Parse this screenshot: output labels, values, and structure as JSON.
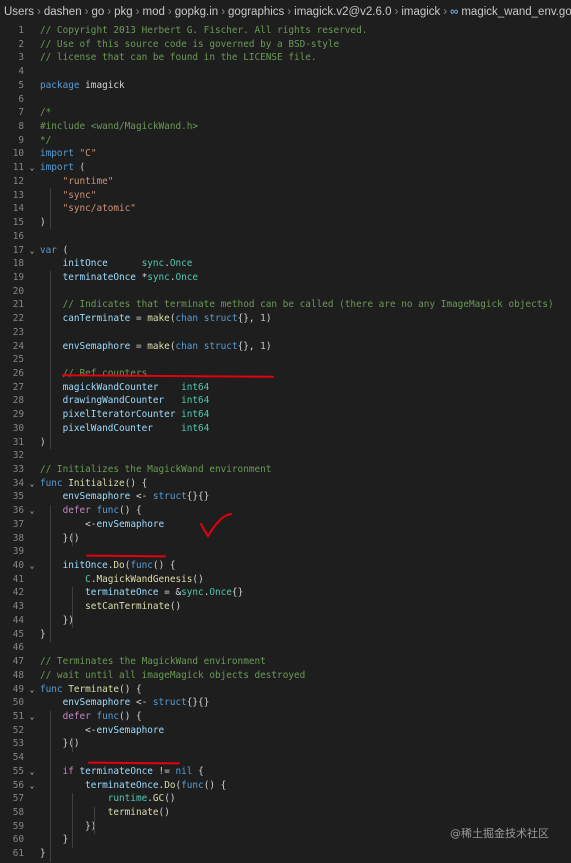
{
  "breadcrumb": {
    "items": [
      "Users",
      "dashen",
      "go",
      "pkg",
      "mod",
      "gopkg.in",
      "gographics",
      "imagick.v2@v2.6.0",
      "imagick"
    ],
    "file": "magick_wand_env.go"
  },
  "lines": [
    {
      "n": "1",
      "t": [
        [
          "cm",
          "// Copyright 2013 Herbert G. Fischer. All rights reserved."
        ]
      ]
    },
    {
      "n": "2",
      "t": [
        [
          "cm",
          "// Use of this source code is governed by a BSD-style"
        ]
      ]
    },
    {
      "n": "3",
      "t": [
        [
          "cm",
          "// license that can be found in the LICENSE file."
        ]
      ]
    },
    {
      "n": "4",
      "t": []
    },
    {
      "n": "5",
      "t": [
        [
          "kw",
          "package"
        ],
        [
          "code",
          " imagick"
        ]
      ]
    },
    {
      "n": "6",
      "t": []
    },
    {
      "n": "7",
      "t": [
        [
          "cm",
          "/*"
        ]
      ]
    },
    {
      "n": "8",
      "t": [
        [
          "cm",
          "#include <wand/MagickWand.h>"
        ]
      ]
    },
    {
      "n": "9",
      "t": [
        [
          "cm",
          "*/"
        ]
      ]
    },
    {
      "n": "10",
      "t": [
        [
          "kw",
          "import"
        ],
        [
          "code",
          " "
        ],
        [
          "str",
          "\"C\""
        ]
      ]
    },
    {
      "n": "11",
      "fold": "⌄",
      "t": [
        [
          "kw",
          "import"
        ],
        [
          "code",
          " ("
        ]
      ]
    },
    {
      "n": "12",
      "t": [
        [
          "code",
          "    "
        ],
        [
          "str",
          "\"runtime\""
        ]
      ]
    },
    {
      "n": "13",
      "t": [
        [
          "code",
          "    "
        ],
        [
          "str",
          "\"sync\""
        ]
      ]
    },
    {
      "n": "14",
      "t": [
        [
          "code",
          "    "
        ],
        [
          "str",
          "\"sync/atomic\""
        ]
      ]
    },
    {
      "n": "15",
      "t": [
        [
          "code",
          ")"
        ]
      ]
    },
    {
      "n": "16",
      "t": []
    },
    {
      "n": "17",
      "fold": "⌄",
      "t": [
        [
          "kw",
          "var"
        ],
        [
          "code",
          " ("
        ]
      ]
    },
    {
      "n": "18",
      "t": [
        [
          "code",
          "    "
        ],
        [
          "var",
          "initOnce"
        ],
        [
          "code",
          "      "
        ],
        [
          "ty",
          "sync"
        ],
        [
          "code",
          "."
        ],
        [
          "ty",
          "Once"
        ]
      ]
    },
    {
      "n": "19",
      "t": [
        [
          "code",
          "    "
        ],
        [
          "var",
          "terminateOnce"
        ],
        [
          "code",
          " *"
        ],
        [
          "ty",
          "sync"
        ],
        [
          "code",
          "."
        ],
        [
          "ty",
          "Once"
        ]
      ]
    },
    {
      "n": "20",
      "t": []
    },
    {
      "n": "21",
      "t": [
        [
          "code",
          "    "
        ],
        [
          "cm",
          "// Indicates that terminate method can be called (there are no any ImageMagick objects)"
        ]
      ]
    },
    {
      "n": "22",
      "t": [
        [
          "code",
          "    "
        ],
        [
          "var",
          "canTerminate"
        ],
        [
          "code",
          " = "
        ],
        [
          "fn",
          "make"
        ],
        [
          "code",
          "("
        ],
        [
          "kw",
          "chan"
        ],
        [
          "code",
          " "
        ],
        [
          "kw",
          "struct"
        ],
        [
          "code",
          "{}, "
        ],
        [
          "num",
          "1"
        ],
        [
          "code",
          ")"
        ]
      ]
    },
    {
      "n": "23",
      "t": []
    },
    {
      "n": "24",
      "t": [
        [
          "code",
          "    "
        ],
        [
          "var",
          "envSemaphore"
        ],
        [
          "code",
          " = "
        ],
        [
          "fn",
          "make"
        ],
        [
          "code",
          "("
        ],
        [
          "kw",
          "chan"
        ],
        [
          "code",
          " "
        ],
        [
          "kw",
          "struct"
        ],
        [
          "code",
          "{}, "
        ],
        [
          "num",
          "1"
        ],
        [
          "code",
          ")"
        ]
      ]
    },
    {
      "n": "25",
      "t": []
    },
    {
      "n": "26",
      "t": [
        [
          "code",
          "    "
        ],
        [
          "cm",
          "// Ref counters"
        ]
      ]
    },
    {
      "n": "27",
      "t": [
        [
          "code",
          "    "
        ],
        [
          "var",
          "magickWandCounter"
        ],
        [
          "code",
          "    "
        ],
        [
          "ty",
          "int64"
        ]
      ]
    },
    {
      "n": "28",
      "t": [
        [
          "code",
          "    "
        ],
        [
          "var",
          "drawingWandCounter"
        ],
        [
          "code",
          "   "
        ],
        [
          "ty",
          "int64"
        ]
      ]
    },
    {
      "n": "29",
      "t": [
        [
          "code",
          "    "
        ],
        [
          "var",
          "pixelIteratorCounter"
        ],
        [
          "code",
          " "
        ],
        [
          "ty",
          "int64"
        ]
      ]
    },
    {
      "n": "30",
      "t": [
        [
          "code",
          "    "
        ],
        [
          "var",
          "pixelWandCounter"
        ],
        [
          "code",
          "     "
        ],
        [
          "ty",
          "int64"
        ]
      ]
    },
    {
      "n": "31",
      "t": [
        [
          "code",
          ")"
        ]
      ]
    },
    {
      "n": "32",
      "t": []
    },
    {
      "n": "33",
      "t": [
        [
          "cm",
          "// Initializes the MagickWand environment"
        ]
      ]
    },
    {
      "n": "34",
      "fold": "⌄",
      "t": [
        [
          "kw",
          "func"
        ],
        [
          "code",
          " "
        ],
        [
          "fn",
          "Initialize"
        ],
        [
          "code",
          "() {"
        ]
      ]
    },
    {
      "n": "35",
      "t": [
        [
          "code",
          "    "
        ],
        [
          "var",
          "envSemaphore"
        ],
        [
          "code",
          " <- "
        ],
        [
          "kw",
          "struct"
        ],
        [
          "code",
          "{}{}"
        ]
      ]
    },
    {
      "n": "36",
      "fold": "⌄",
      "t": [
        [
          "code",
          "    "
        ],
        [
          "ctl",
          "defer"
        ],
        [
          "code",
          " "
        ],
        [
          "kw",
          "func"
        ],
        [
          "code",
          "() {"
        ]
      ]
    },
    {
      "n": "37",
      "t": [
        [
          "code",
          "        <-"
        ],
        [
          "var",
          "envSemaphore"
        ]
      ]
    },
    {
      "n": "38",
      "t": [
        [
          "code",
          "    }()"
        ]
      ]
    },
    {
      "n": "39",
      "t": []
    },
    {
      "n": "40",
      "fold": "⌄",
      "t": [
        [
          "code",
          "    "
        ],
        [
          "var",
          "initOnce"
        ],
        [
          "code",
          "."
        ],
        [
          "fn",
          "Do"
        ],
        [
          "code",
          "("
        ],
        [
          "kw",
          "func"
        ],
        [
          "code",
          "() {"
        ]
      ]
    },
    {
      "n": "41",
      "t": [
        [
          "code",
          "        "
        ],
        [
          "ty",
          "C"
        ],
        [
          "code",
          "."
        ],
        [
          "fn",
          "MagickWandGenesis"
        ],
        [
          "code",
          "()"
        ]
      ]
    },
    {
      "n": "42",
      "t": [
        [
          "code",
          "        "
        ],
        [
          "var",
          "terminateOnce"
        ],
        [
          "code",
          " = &"
        ],
        [
          "ty",
          "sync"
        ],
        [
          "code",
          "."
        ],
        [
          "ty",
          "Once"
        ],
        [
          "code",
          "{}"
        ]
      ]
    },
    {
      "n": "43",
      "t": [
        [
          "code",
          "        "
        ],
        [
          "fn",
          "setCanTerminate"
        ],
        [
          "code",
          "()"
        ]
      ]
    },
    {
      "n": "44",
      "t": [
        [
          "code",
          "    })"
        ]
      ]
    },
    {
      "n": "45",
      "t": [
        [
          "code",
          "}"
        ]
      ]
    },
    {
      "n": "46",
      "t": []
    },
    {
      "n": "47",
      "t": [
        [
          "cm",
          "// Terminates the MagickWand environment"
        ]
      ]
    },
    {
      "n": "48",
      "t": [
        [
          "cm",
          "// wait until all imageMagick objects destroyed"
        ]
      ]
    },
    {
      "n": "49",
      "fold": "⌄",
      "t": [
        [
          "kw",
          "func"
        ],
        [
          "code",
          " "
        ],
        [
          "fn",
          "Terminate"
        ],
        [
          "code",
          "() {"
        ]
      ]
    },
    {
      "n": "50",
      "t": [
        [
          "code",
          "    "
        ],
        [
          "var",
          "envSemaphore"
        ],
        [
          "code",
          " <- "
        ],
        [
          "kw",
          "struct"
        ],
        [
          "code",
          "{}{}"
        ]
      ]
    },
    {
      "n": "51",
      "fold": "⌄",
      "t": [
        [
          "code",
          "    "
        ],
        [
          "ctl",
          "defer"
        ],
        [
          "code",
          " "
        ],
        [
          "kw",
          "func"
        ],
        [
          "code",
          "() {"
        ]
      ]
    },
    {
      "n": "52",
      "t": [
        [
          "code",
          "        <-"
        ],
        [
          "var",
          "envSemaphore"
        ]
      ]
    },
    {
      "n": "53",
      "t": [
        [
          "code",
          "    }()"
        ]
      ]
    },
    {
      "n": "54",
      "t": []
    },
    {
      "n": "55",
      "fold": "⌄",
      "t": [
        [
          "code",
          "    "
        ],
        [
          "ctl",
          "if"
        ],
        [
          "code",
          " "
        ],
        [
          "var",
          "terminateOnce"
        ],
        [
          "code",
          " != "
        ],
        [
          "kw",
          "nil"
        ],
        [
          "code",
          " {"
        ]
      ]
    },
    {
      "n": "56",
      "fold": "⌄",
      "t": [
        [
          "code",
          "        "
        ],
        [
          "var",
          "terminateOnce"
        ],
        [
          "code",
          "."
        ],
        [
          "fn",
          "Do"
        ],
        [
          "code",
          "("
        ],
        [
          "kw",
          "func"
        ],
        [
          "code",
          "() {"
        ]
      ]
    },
    {
      "n": "57",
      "t": [
        [
          "code",
          "            "
        ],
        [
          "ty",
          "runtime"
        ],
        [
          "code",
          "."
        ],
        [
          "fn",
          "GC"
        ],
        [
          "code",
          "()"
        ]
      ]
    },
    {
      "n": "58",
      "t": [
        [
          "code",
          "            "
        ],
        [
          "fn",
          "terminate"
        ],
        [
          "code",
          "()"
        ]
      ]
    },
    {
      "n": "59",
      "t": [
        [
          "code",
          "        })"
        ]
      ]
    },
    {
      "n": "60",
      "t": [
        [
          "code",
          "    }"
        ]
      ]
    },
    {
      "n": "61",
      "t": [
        [
          "code",
          "}"
        ]
      ]
    }
  ],
  "watermark": "@稀土掘金技术社区",
  "colors": {
    "background": "#1e1e1e",
    "annotation": "#e3000f",
    "comment": "#6a9955",
    "keyword": "#569cd6"
  }
}
